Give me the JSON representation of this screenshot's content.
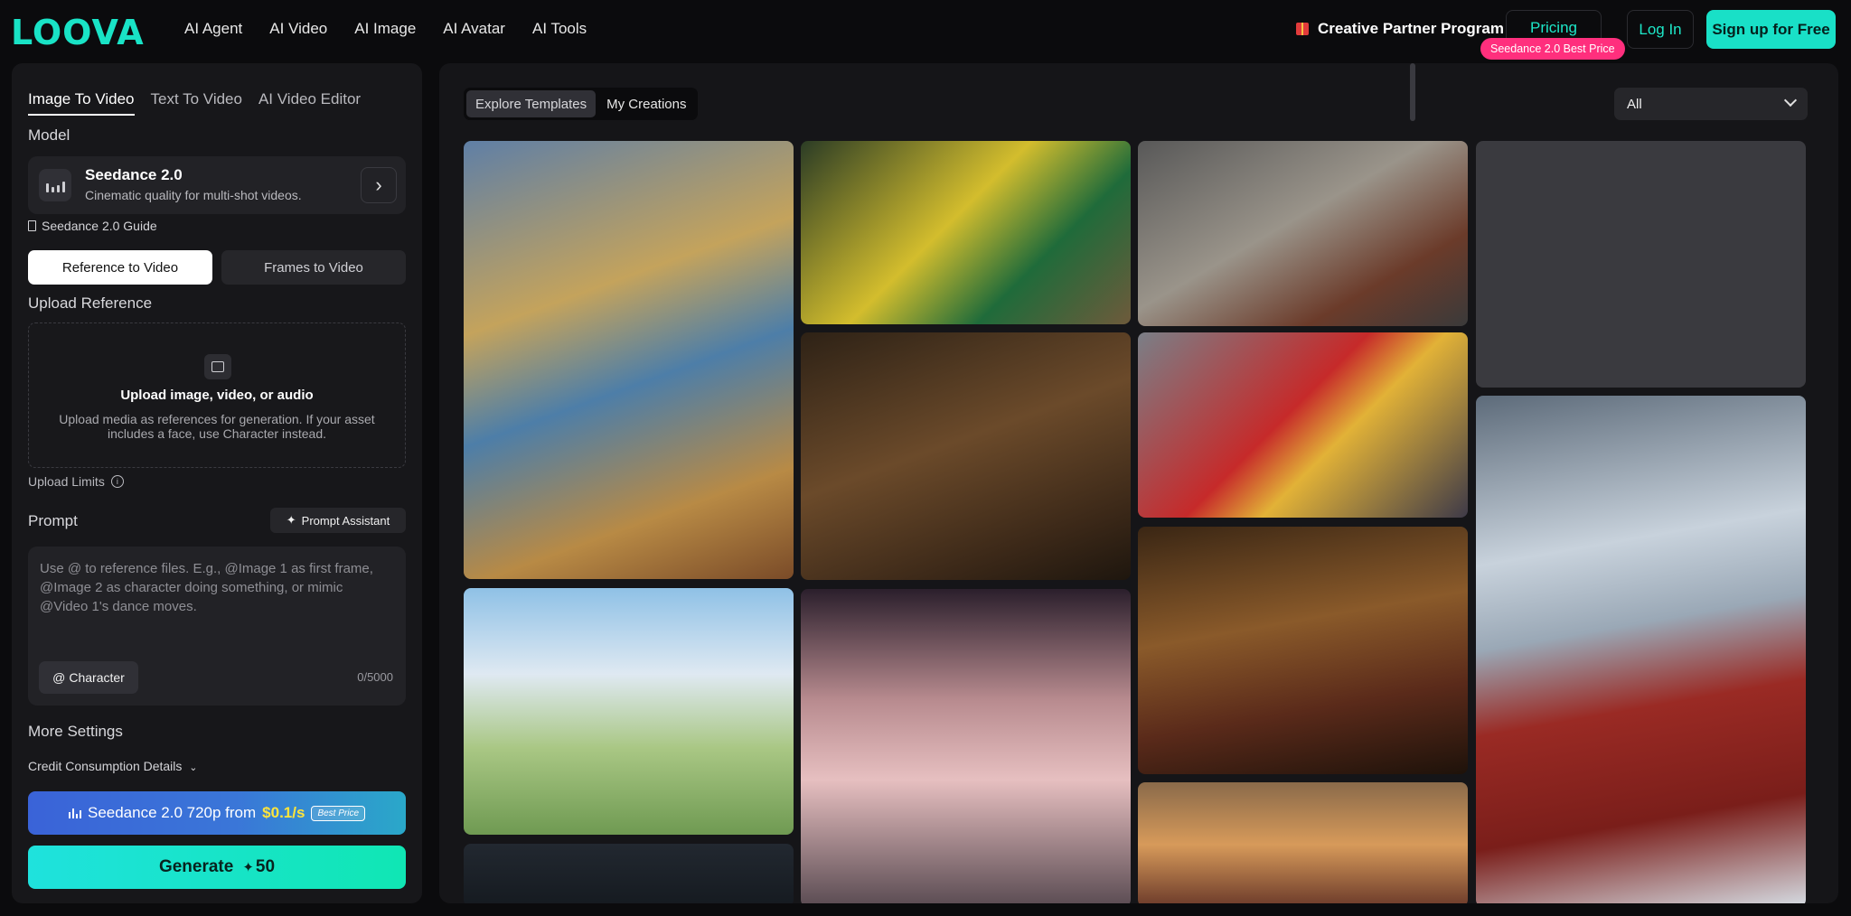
{
  "nav": {
    "logo": "LOOVA",
    "links": [
      "AI Agent",
      "AI Video",
      "AI Image",
      "AI Avatar",
      "AI Tools"
    ],
    "partner_program": "Creative Partner Program",
    "pricing": "Pricing",
    "pricing_badge": "Seedance 2.0 Best Price",
    "login": "Log In",
    "signup": "Sign up for Free"
  },
  "panel": {
    "tabs": [
      "Image To Video",
      "Text To Video",
      "AI Video Editor"
    ],
    "model_label": "Model",
    "model_name": "Seedance 2.0",
    "model_desc": "Cinematic quality for multi-shot videos.",
    "guide": "Seedance 2.0 Guide",
    "mode_active": "Reference to Video",
    "mode_inactive": "Frames to Video",
    "upload_label": "Upload Reference",
    "upload_title": "Upload image, video, or audio",
    "upload_desc": "Upload media as references for generation. If your asset includes a face, use Character instead.",
    "upload_limits": "Upload Limits",
    "prompt_label": "Prompt",
    "prompt_assistant": "Prompt Assistant",
    "prompt_placeholder": "Use @ to reference files. E.g., @Image 1 as first frame, @Image 2 as character doing something, or mimic @Video 1's dance moves.",
    "character": "Character",
    "counter": "0/5000",
    "more_settings": "More Settings",
    "credit_details": "Credit Consumption Details",
    "promo_text": "Seedance 2.0 720p from",
    "promo_price": "$0.1/s",
    "promo_badge": "Best Price",
    "generate": "Generate",
    "generate_cost": "50"
  },
  "gallery": {
    "tabs": [
      "Explore Templates",
      "My Creations"
    ],
    "filter": "All"
  }
}
